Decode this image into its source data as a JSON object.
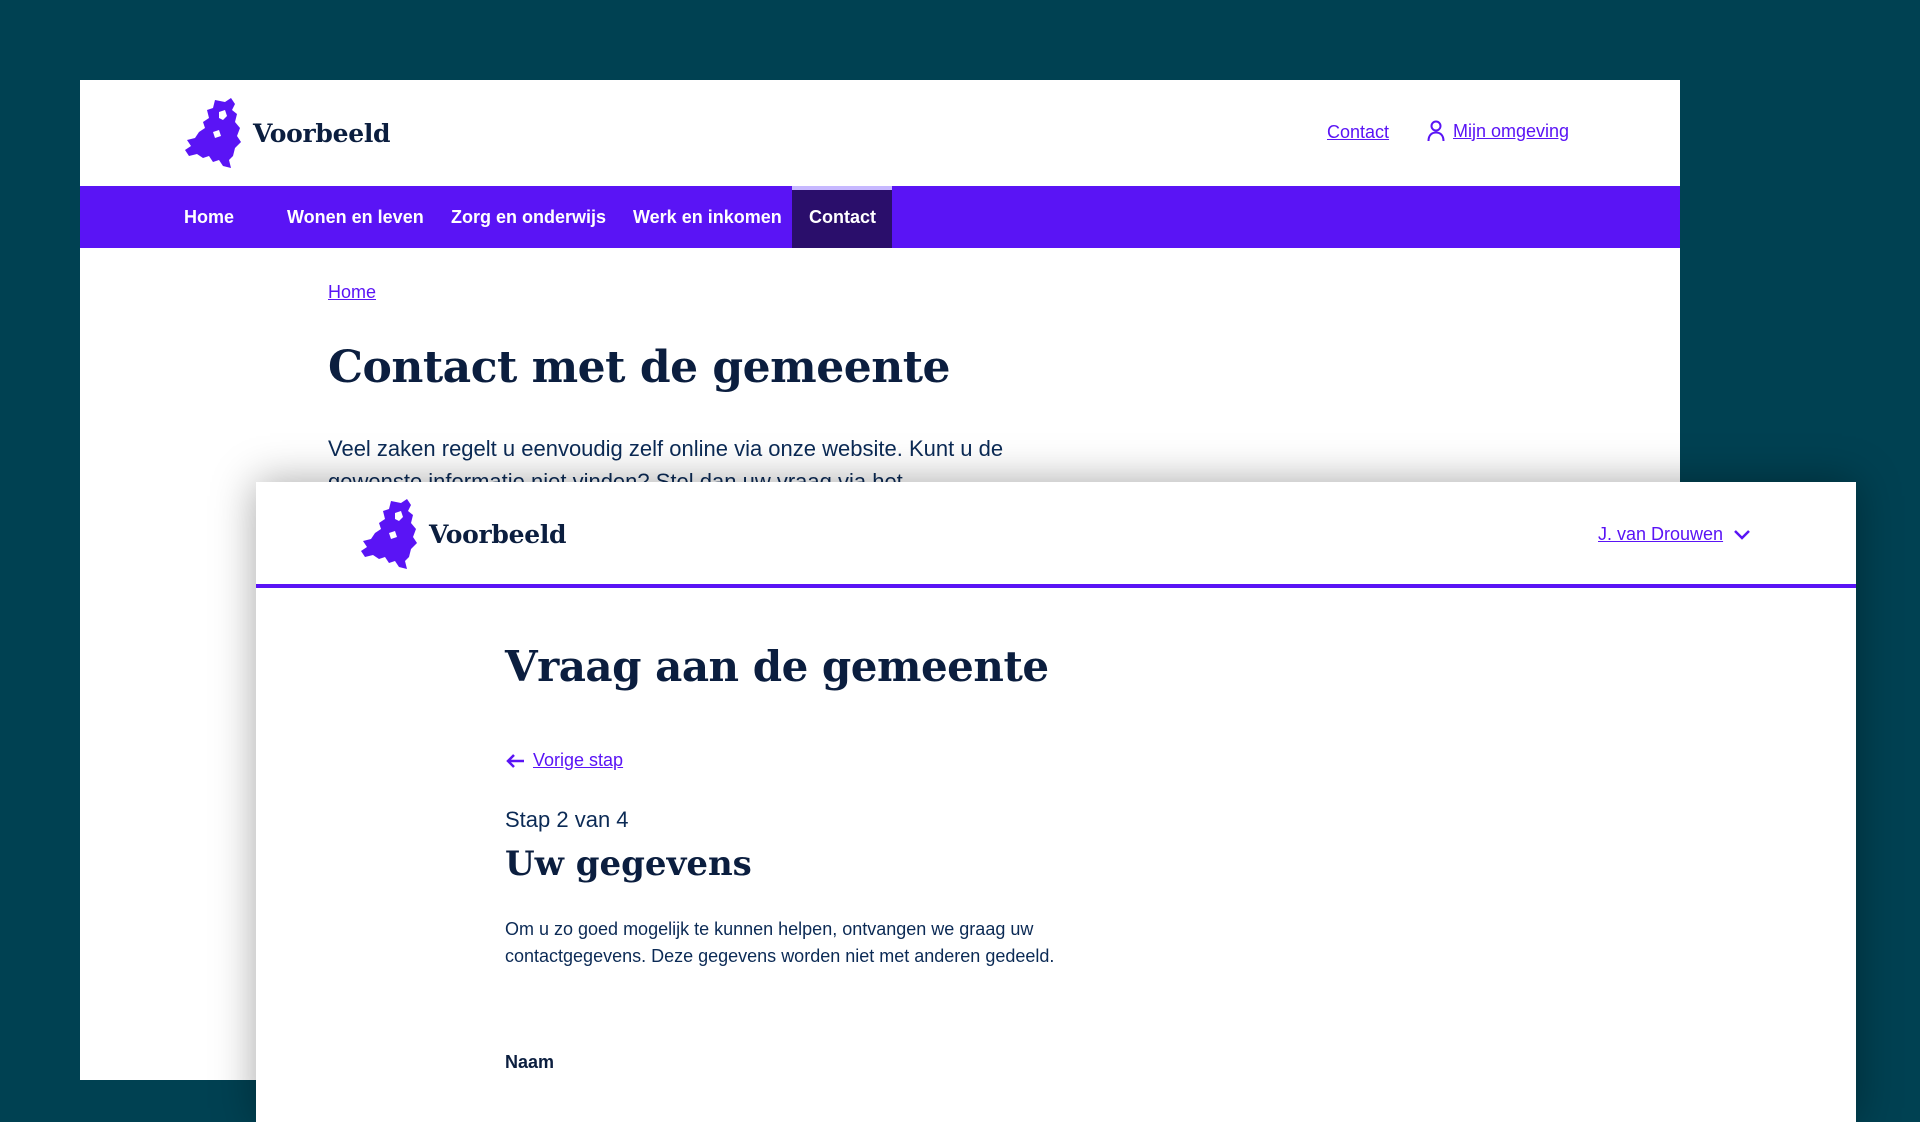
{
  "colors": {
    "background": "#004152",
    "accent": "#5a14f5",
    "nav_active": "#2a0e6b",
    "heading": "#0b1e3f"
  },
  "back_window": {
    "logo_text": "Voorbeeld",
    "utility": {
      "contact": "Contact",
      "mijn_omgeving": "Mijn omgeving"
    },
    "nav": [
      "Home",
      "Wonen en leven",
      "Zorg en onderwijs",
      "Werk en inkomen",
      "Contact"
    ],
    "nav_active": "Contact",
    "breadcrumb": "Home",
    "title": "Contact met de gemeente",
    "intro": "Veel zaken regelt u eenvoudig zelf online via onze website. Kunt u de gewenste informatie niet vinden? Stel dan uw vraag via het"
  },
  "front_window": {
    "logo_text": "Voorbeeld",
    "user": "J. van Drouwen",
    "title": "Vraag aan de gemeente",
    "back_link": "Vorige stap",
    "step": "Stap 2 van 4",
    "subtitle": "Uw gegevens",
    "description": "Om u zo goed mogelijk te kunnen helpen, ontvangen we graag uw contactgegevens. Deze gegevens worden niet met anderen gedeeld.",
    "field_label": "Naam"
  }
}
